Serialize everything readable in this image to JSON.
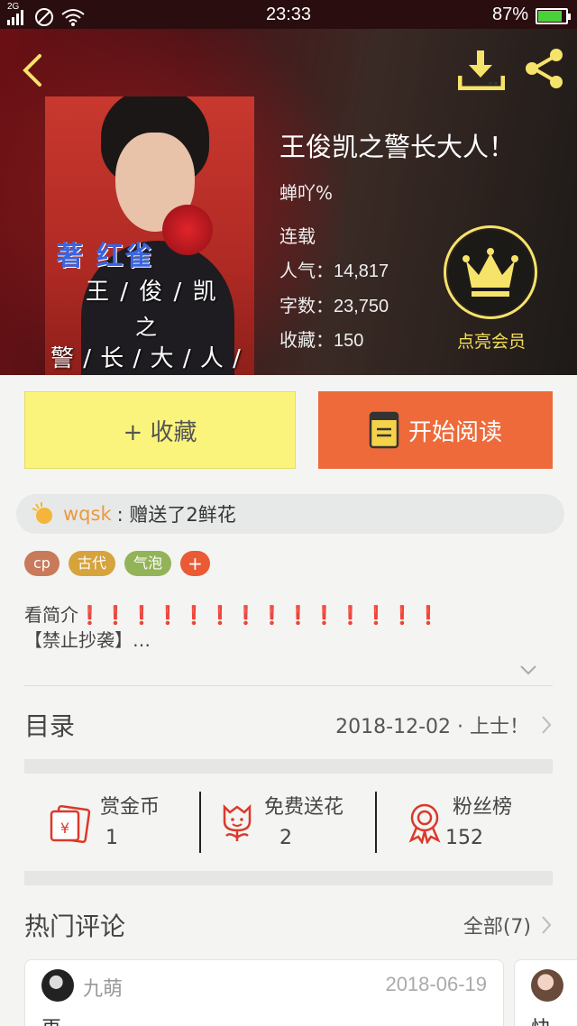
{
  "status_bar": {
    "network": "2G",
    "time": "23:33",
    "battery": "87%",
    "battery_level": 0.87
  },
  "book": {
    "title": "王俊凯之警长大人！",
    "author": "蝉吖%",
    "status": "连载",
    "popularity": "人气：14,817",
    "word_count": "字数：23,750",
    "favorites": "收藏：150",
    "cover_text": {
      "line1": "著 红雀",
      "line2": "王 / 俊 / 凯",
      "line3": "之",
      "line4": "警 / 长 / 大 / 人 / !"
    }
  },
  "vip": {
    "label": "点亮会员"
  },
  "actions": {
    "favorite": "+ 收藏",
    "read": "开始阅读"
  },
  "gift_ticker": {
    "user": "wqsk",
    "message": ": 赠送了2鲜花"
  },
  "tags": [
    {
      "label": "cp",
      "color": "#c97a5a"
    },
    {
      "label": "古代",
      "color": "#d6a33d"
    },
    {
      "label": "气泡",
      "color": "#93b358"
    },
    {
      "label": "+",
      "color": "#ea5a35"
    }
  ],
  "summary": {
    "line1": "看简介",
    "marks": "❗❗❗❗❗❗❗❗❗❗❗❗❗❗",
    "line2": "【禁止抄袭】…"
  },
  "toc": {
    "label": "目录",
    "latest": "2018-12-02 · 上士！"
  },
  "stats": [
    {
      "label": "赏金币",
      "value": "1",
      "icon": "red-envelope-icon"
    },
    {
      "label": "免费送花",
      "value": "2",
      "icon": "flower-icon"
    },
    {
      "label": "粉丝榜",
      "value": "152",
      "icon": "medal-icon"
    }
  ],
  "comments": {
    "title": "热门评论",
    "all": "全部(7)",
    "first": {
      "user": "九萌",
      "date": "2018-06-19",
      "text": "再"
    },
    "second": {
      "text": "快"
    }
  },
  "colors": {
    "accent_yellow": "#fbf47c",
    "accent_orange": "#ee6a3a",
    "gold": "#f3df56"
  }
}
